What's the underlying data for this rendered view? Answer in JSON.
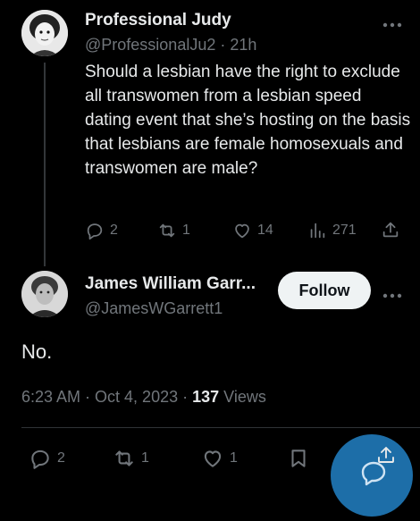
{
  "parent_tweet": {
    "author_name": "Professional Judy",
    "handle": "@ProfessionalJu2",
    "separator": "·",
    "time": "21h",
    "text": "Should a lesbian have the right to exclude all transwomen from a lesbian speed dating event that she’s hosting on the basis that lesbians are female homosexuals and transwomen are male?",
    "actions": {
      "replies": "2",
      "reposts": "1",
      "likes": "14",
      "views": "271"
    }
  },
  "reply_tweet": {
    "author_name": "James William Garr...",
    "handle": "@JamesWGarrett1",
    "follow_label": "Follow",
    "text": "No.",
    "timestamp": "6:23 AM · Oct 4, 2023 ·",
    "views_count": "137",
    "views_label": "Views",
    "actions": {
      "replies": "2",
      "reposts": "1",
      "likes": "1"
    }
  },
  "icons": {
    "reply": "reply-icon",
    "repost": "repost-icon",
    "like": "heart-icon",
    "views": "views-icon",
    "share": "share-icon",
    "bookmark": "bookmark-icon",
    "more": "more-icon"
  },
  "colors": {
    "background": "#000000",
    "text": "#e7e9ea",
    "secondary": "#71767b",
    "fab": "#1d6ea8"
  }
}
